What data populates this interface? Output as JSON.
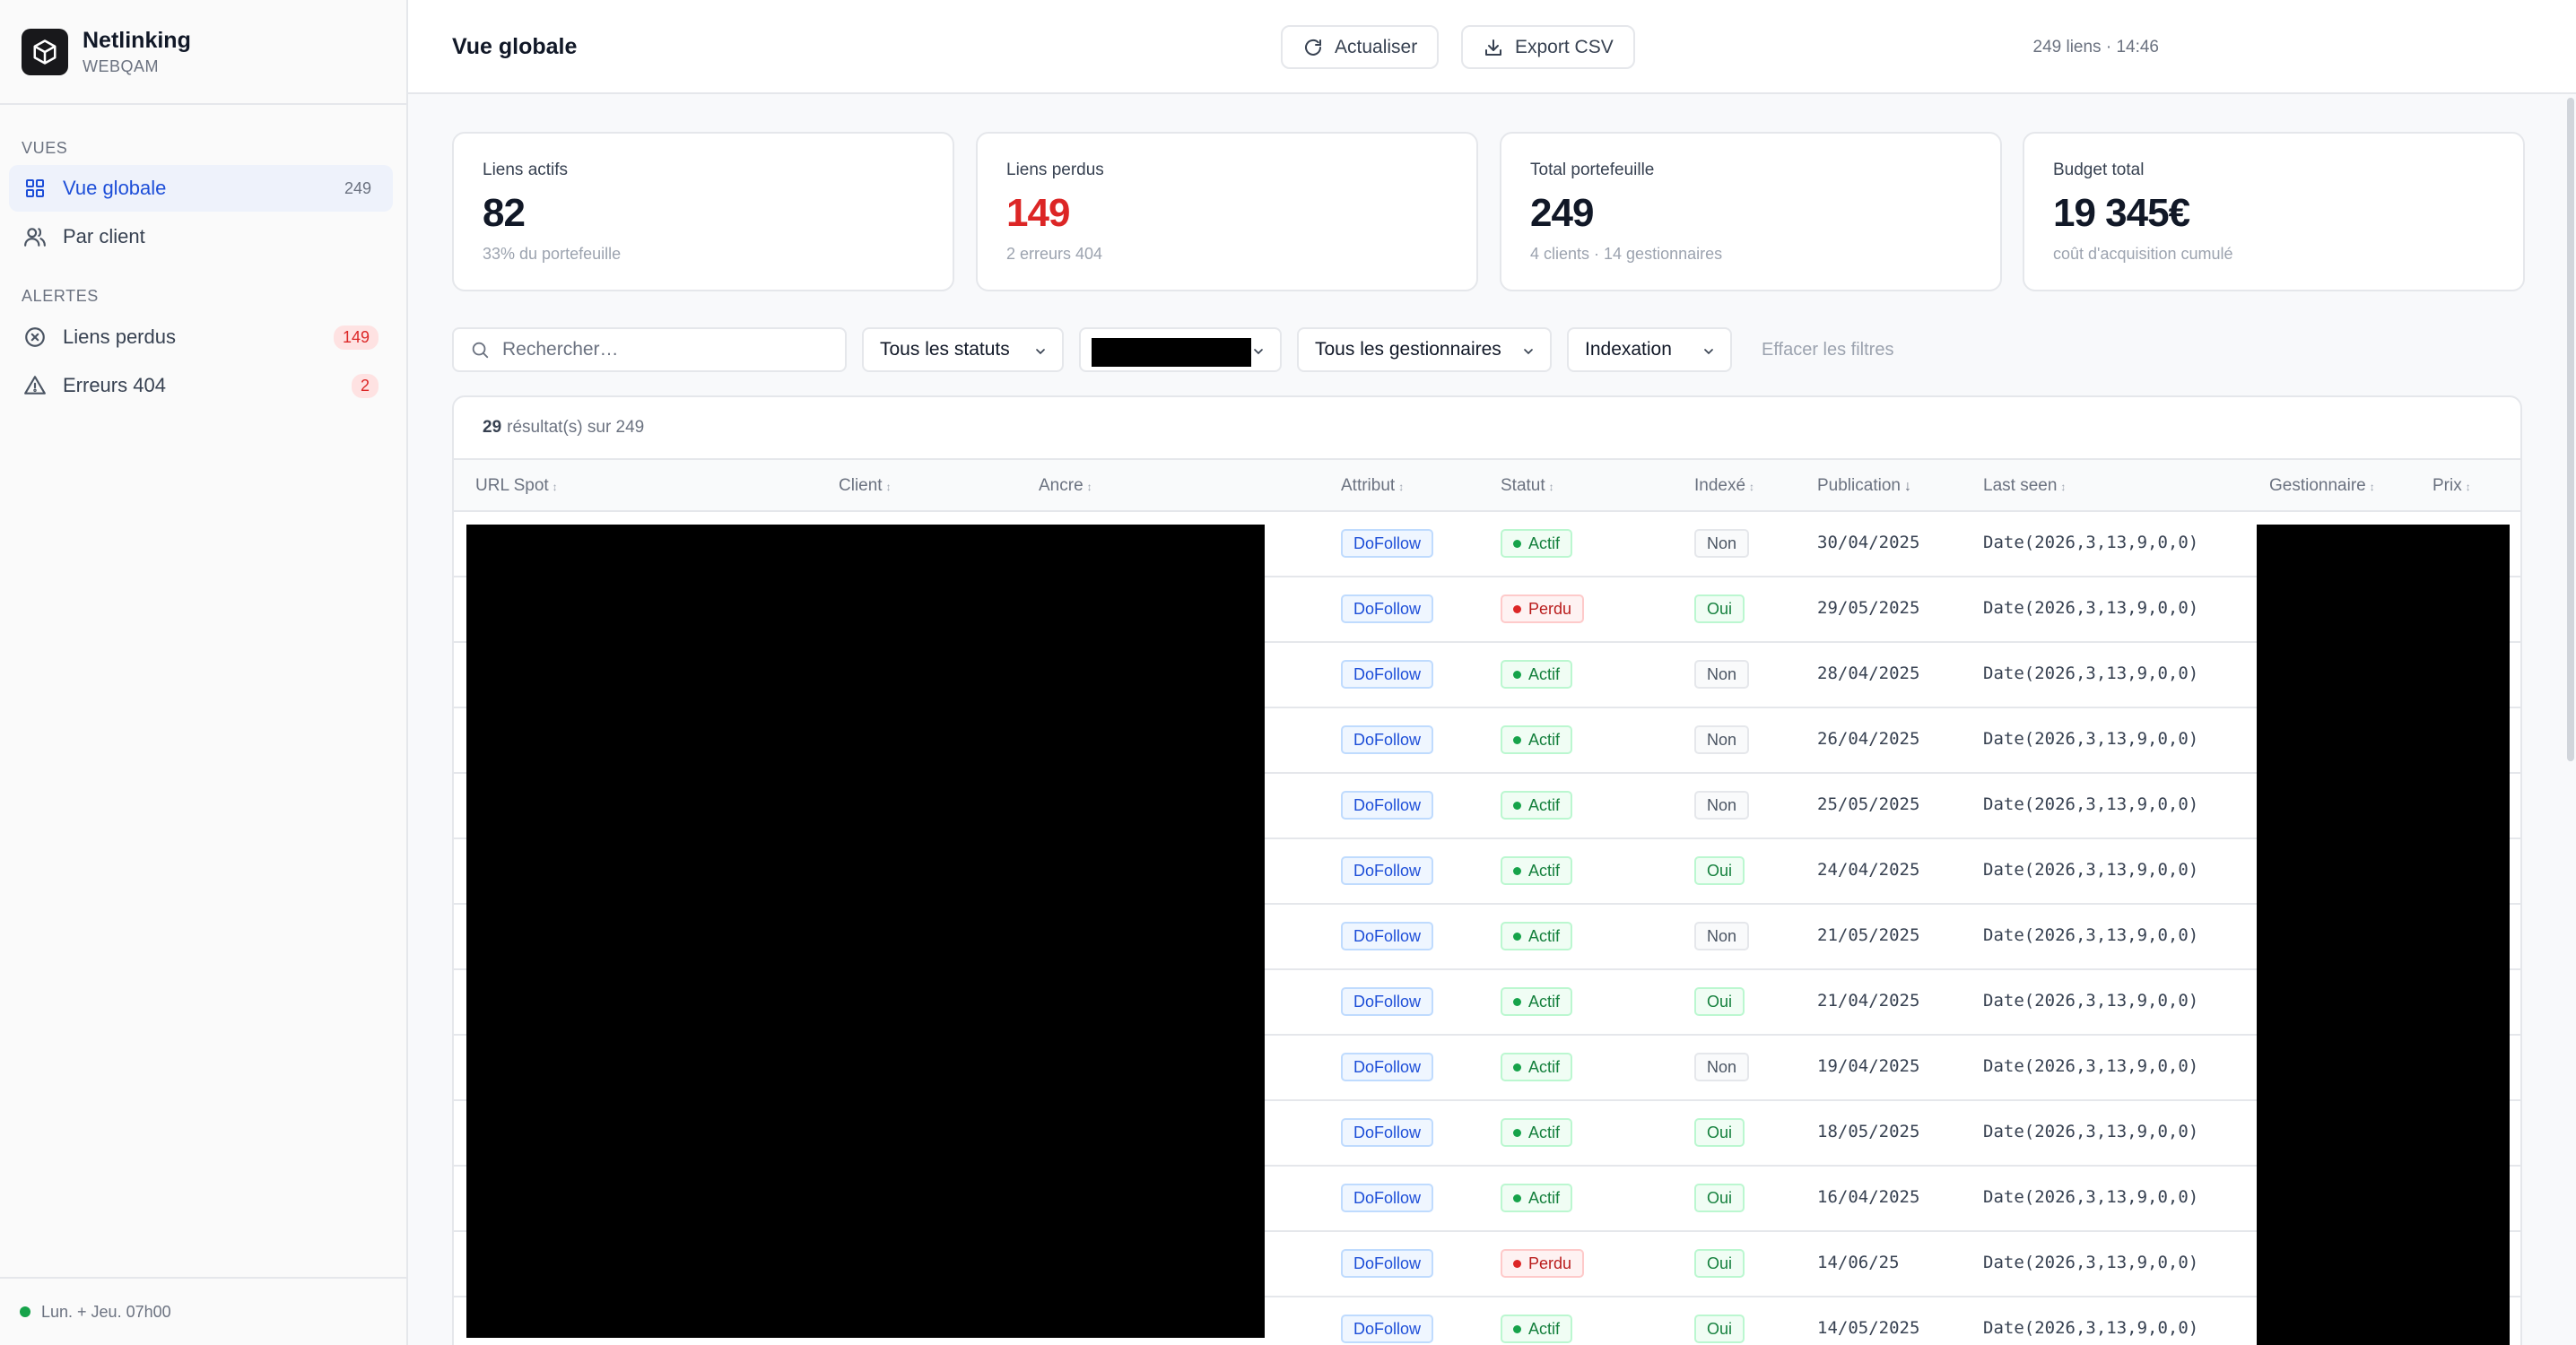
{
  "brand": {
    "title": "Netlinking",
    "subtitle": "WEBQAM"
  },
  "sidebar": {
    "views_label": "VUES",
    "views": [
      {
        "label": "Vue globale",
        "count": "249",
        "icon": "grid-icon",
        "active": true
      },
      {
        "label": "Par client",
        "icon": "users-icon"
      }
    ],
    "alerts_label": "ALERTES",
    "alerts": [
      {
        "label": "Liens perdus",
        "count": "149",
        "icon": "x-circle-icon"
      },
      {
        "label": "Erreurs 404",
        "count": "2",
        "icon": "warning-triangle-icon"
      }
    ],
    "footer": "Lun. + Jeu. 07h00"
  },
  "header": {
    "title": "Vue globale",
    "meta": "249 liens · 14:46",
    "refresh_label": "Actualiser",
    "export_label": "Export CSV"
  },
  "stats": [
    {
      "label": "Liens actifs",
      "value": "82",
      "sub": "33% du portefeuille"
    },
    {
      "label": "Liens perdus",
      "value": "149",
      "sub": "2 erreurs 404",
      "color": "#dc2626"
    },
    {
      "label": "Total portefeuille",
      "value": "249",
      "sub": "4 clients · 14 gestionnaires"
    },
    {
      "label": "Budget total",
      "value": "19 345€",
      "sub": "coût d'acquisition cumulé"
    }
  ],
  "filters": {
    "search_placeholder": "Rechercher…",
    "status": "Tous les statuts",
    "managers": "Tous les gestionnaires",
    "indexation": "Indexation",
    "clear": "Effacer les filtres"
  },
  "table": {
    "results_count": "29",
    "results_text": "résultat(s) sur 249",
    "columns": [
      "URL Spot",
      "Client",
      "Ancre",
      "Attribut",
      "Statut",
      "Indexé",
      "Publication",
      "Last seen",
      "Gestionnaire",
      "Prix"
    ],
    "rows": [
      {
        "attribut": "DoFollow",
        "statut": "Actif",
        "indexe": "Non",
        "publication": "30/04/2025",
        "last_seen": "Date(2026,3,13,9,0,0)"
      },
      {
        "attribut": "DoFollow",
        "statut": "Perdu",
        "indexe": "Oui",
        "publication": "29/05/2025",
        "last_seen": "Date(2026,3,13,9,0,0)"
      },
      {
        "attribut": "DoFollow",
        "statut": "Actif",
        "indexe": "Non",
        "publication": "28/04/2025",
        "last_seen": "Date(2026,3,13,9,0,0)"
      },
      {
        "attribut": "DoFollow",
        "statut": "Actif",
        "indexe": "Non",
        "publication": "26/04/2025",
        "last_seen": "Date(2026,3,13,9,0,0)"
      },
      {
        "attribut": "DoFollow",
        "statut": "Actif",
        "indexe": "Non",
        "publication": "25/05/2025",
        "last_seen": "Date(2026,3,13,9,0,0)"
      },
      {
        "attribut": "DoFollow",
        "statut": "Actif",
        "indexe": "Oui",
        "publication": "24/04/2025",
        "last_seen": "Date(2026,3,13,9,0,0)"
      },
      {
        "attribut": "DoFollow",
        "statut": "Actif",
        "indexe": "Non",
        "publication": "21/05/2025",
        "last_seen": "Date(2026,3,13,9,0,0)"
      },
      {
        "attribut": "DoFollow",
        "statut": "Actif",
        "indexe": "Oui",
        "publication": "21/04/2025",
        "last_seen": "Date(2026,3,13,9,0,0)"
      },
      {
        "attribut": "DoFollow",
        "statut": "Actif",
        "indexe": "Non",
        "publication": "19/04/2025",
        "last_seen": "Date(2026,3,13,9,0,0)"
      },
      {
        "attribut": "DoFollow",
        "statut": "Actif",
        "indexe": "Oui",
        "publication": "18/05/2025",
        "last_seen": "Date(2026,3,13,9,0,0)"
      },
      {
        "attribut": "DoFollow",
        "statut": "Actif",
        "indexe": "Oui",
        "publication": "16/04/2025",
        "last_seen": "Date(2026,3,13,9,0,0)"
      },
      {
        "attribut": "DoFollow",
        "statut": "Perdu",
        "indexe": "Oui",
        "publication": "14/06/25",
        "last_seen": "Date(2026,3,13,9,0,0)"
      },
      {
        "attribut": "DoFollow",
        "statut": "Actif",
        "indexe": "Oui",
        "publication": "14/05/2025",
        "last_seen": "Date(2026,3,13,9,0,0)"
      }
    ]
  }
}
